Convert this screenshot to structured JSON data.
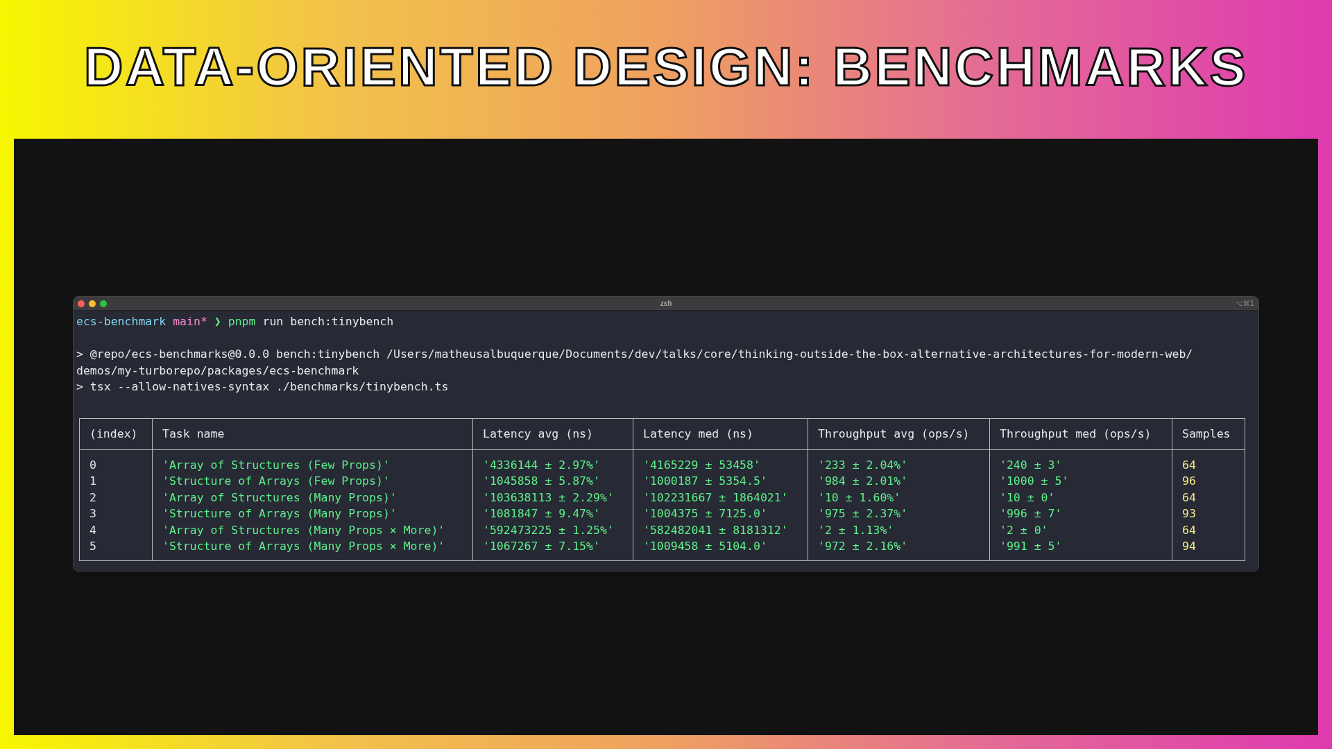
{
  "slide_title": "DATA-ORIENTED DESIGN: BENCHMARKS",
  "terminal": {
    "title": "zsh",
    "shortcut": "⌥⌘1",
    "prompt": {
      "directory": "ecs-benchmark",
      "branch": "main*",
      "symbol": "❯",
      "command": "pnpm",
      "arguments": "run bench:tinybench"
    },
    "output_lines": [
      "> @repo/ecs-benchmarks@0.0.0 bench:tinybench /Users/matheusalbuquerque/Documents/dev/talks/core/thinking-outside-the-box-alternative-architectures-for-modern-web/",
      "demos/my-turborepo/packages/ecs-benchmark",
      "> tsx --allow-natives-syntax ./benchmarks/tinybench.ts"
    ],
    "table": {
      "columns": [
        "(index)",
        "Task name",
        "Latency avg (ns)",
        "Latency med (ns)",
        "Throughput avg (ops/s)",
        "Throughput med (ops/s)",
        "Samples"
      ],
      "rows": [
        [
          "0",
          "'Array of Structures (Few Props)'",
          "'4336144 ± 2.97%'",
          "'4165229 ± 53458'",
          "'233 ± 2.04%'",
          "'240 ± 3'",
          "64"
        ],
        [
          "1",
          "'Structure of Arrays (Few Props)'",
          "'1045858 ± 5.87%'",
          "'1000187 ± 5354.5'",
          "'984 ± 2.01%'",
          "'1000 ± 5'",
          "96"
        ],
        [
          "2",
          "'Array of Structures (Many Props)'",
          "'103638113 ± 2.29%'",
          "'102231667 ± 1864021'",
          "'10 ± 1.60%'",
          "'10 ± 0'",
          "64"
        ],
        [
          "3",
          "'Structure of Arrays (Many Props)'",
          "'1081847 ± 9.47%'",
          "'1004375 ± 7125.0'",
          "'975 ± 2.37%'",
          "'996 ± 7'",
          "93"
        ],
        [
          "4",
          "'Array of Structures (Many Props × More)'",
          "'592473225 ± 1.25%'",
          "'582482041 ± 8181312'",
          "'2 ± 1.13%'",
          "'2 ± 0'",
          "64"
        ],
        [
          "5",
          "'Structure of Arrays (Many Props × More)'",
          "'1067267 ± 7.15%'",
          "'1009458 ± 5104.0'",
          "'972 ± 2.16%'",
          "'991 ± 5'",
          "94"
        ]
      ]
    }
  }
}
